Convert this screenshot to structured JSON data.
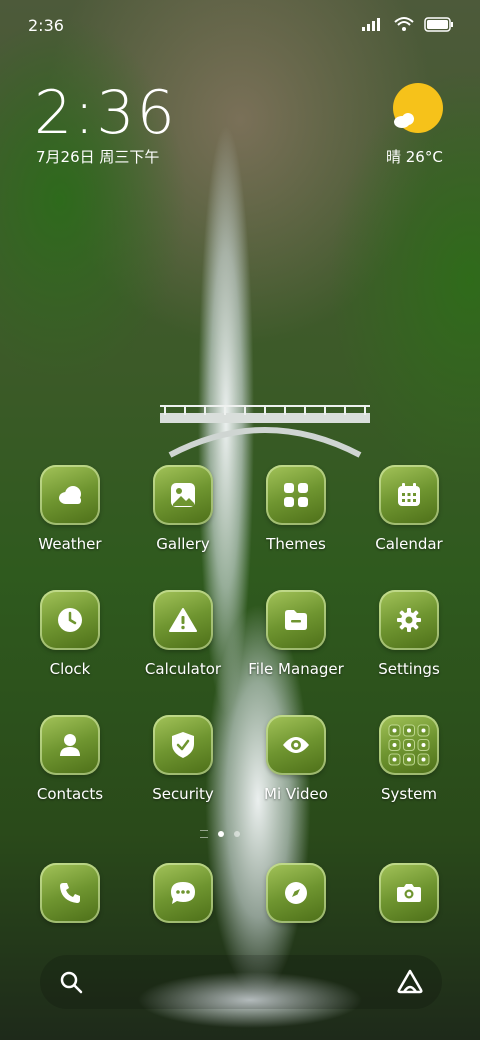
{
  "status_bar": {
    "time": "2:36"
  },
  "widget": {
    "clock": "2:36",
    "date": "7月26日 周三下午",
    "weather": "晴 26°C"
  },
  "apps": [
    {
      "label": "Weather",
      "icon": "weather-icon"
    },
    {
      "label": "Gallery",
      "icon": "gallery-icon"
    },
    {
      "label": "Themes",
      "icon": "themes-icon"
    },
    {
      "label": "Calendar",
      "icon": "calendar-icon"
    },
    {
      "label": "Clock",
      "icon": "clock-icon"
    },
    {
      "label": "Calculator",
      "icon": "warning-icon"
    },
    {
      "label": "File Manager",
      "icon": "folder-icon"
    },
    {
      "label": "Settings",
      "icon": "gear-icon"
    },
    {
      "label": "Contacts",
      "icon": "person-icon"
    },
    {
      "label": "Security",
      "icon": "shield-icon"
    },
    {
      "label": "Mi Video",
      "icon": "eye-icon"
    },
    {
      "label": "System",
      "icon": "folder-grid-icon"
    }
  ],
  "dock": [
    {
      "icon": "phone-icon"
    },
    {
      "icon": "message-icon"
    },
    {
      "icon": "compass-icon"
    },
    {
      "icon": "camera-icon"
    }
  ],
  "colors": {
    "tile_light": "#a4c45a",
    "tile_dark": "#4c6e18",
    "sun": "#f6c21a"
  }
}
